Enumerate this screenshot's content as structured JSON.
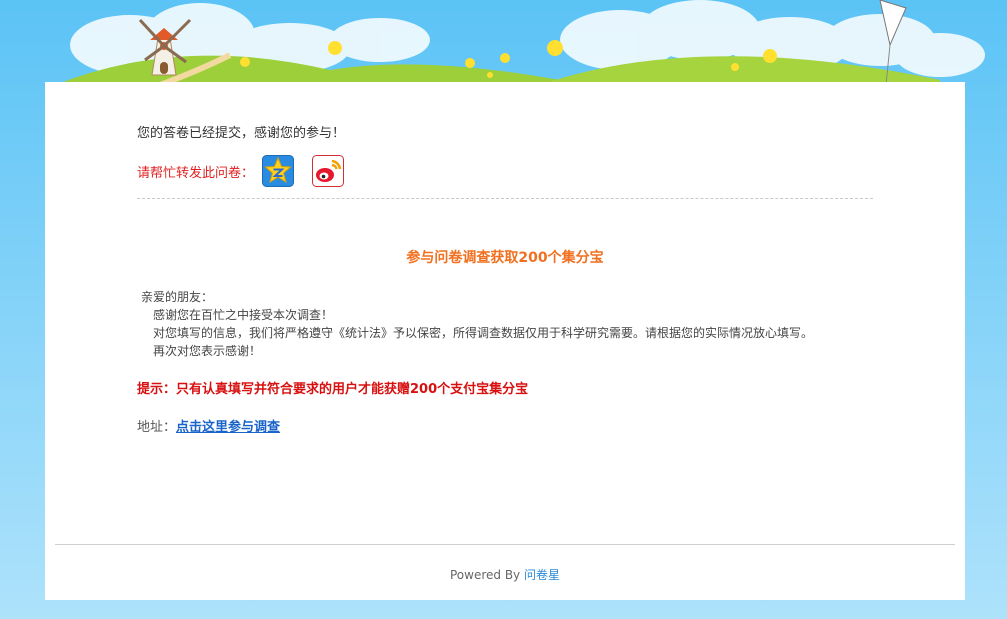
{
  "thanks_message": "您的答卷已经提交，感谢您的参与！",
  "share": {
    "label": "请帮忙转发此问卷：",
    "icons": [
      "qq-zone-icon",
      "weibo-icon"
    ]
  },
  "headline": "参与问卷调查获取200个集分宝",
  "letter": {
    "greeting": "亲爱的朋友：",
    "lines": [
      "感谢您在百忙之中接受本次调查！",
      "对您填写的信息，我们将严格遵守《统计法》予以保密，所得调查数据仅用于科学研究需要。请根据您的实际情况放心填写。",
      "再次对您表示感谢！"
    ]
  },
  "tip": "提示：只有认真填写并符合要求的用户才能获赠200个支付宝集分宝",
  "address": {
    "label": "地址：",
    "link_text": "点击这里参与调查"
  },
  "footer": {
    "powered_by": "Powered By",
    "brand": "问卷星"
  },
  "colors": {
    "sky": "#5bc3f5",
    "share_label": "#e02020",
    "headline": "#f07020",
    "tip": "#d81010",
    "link": "#1a63c8",
    "brand_link": "#2a8ad8"
  }
}
